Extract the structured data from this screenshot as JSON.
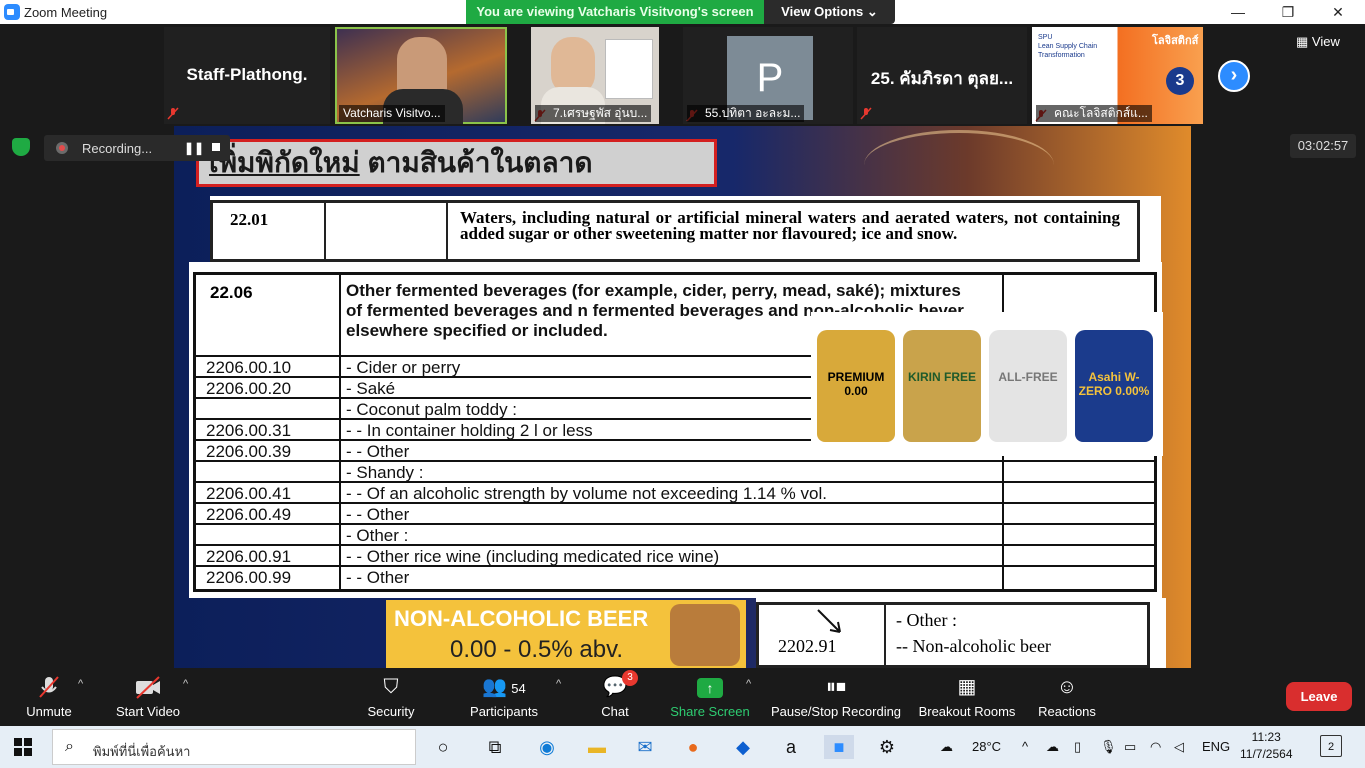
{
  "window": {
    "title": "Zoom Meeting",
    "viewing_banner": "You are viewing Vatcharis Visitvong's screen",
    "view_options": "View Options",
    "view_button": "View"
  },
  "gallery": {
    "tiles": [
      {
        "name": "Staff-Plathong."
      },
      {
        "label": "Vatcharis Visitvo..."
      },
      {
        "label": "7.เศรษฐพัส อุ่นบ..."
      },
      {
        "label": "55.ปทิตา อะละม...",
        "avatar_letter": "P"
      },
      {
        "name": "25. คัมภิรดา ตุลย..."
      },
      {
        "label": "คณะโลจิสติกส์แ..."
      }
    ]
  },
  "recording": {
    "label": "Recording..."
  },
  "timer": "03:02:57",
  "slide": {
    "title_underlined": "เพิ่มพิกัดใหม่",
    "title_rest": " ตามสินค้าในตลาด",
    "top_code": "22.01",
    "top_desc": "Waters, including natural or artificial mineral waters and aerated waters, not containing added sugar or other sweetening matter nor flavoured; ice and snow.",
    "header_code": "22.06",
    "header_desc": "Other fermented beverages (for example, cider, perry, mead, saké); mixtures of fermented beverages and n fermented beverages and non-alcoholic bever elsewhere specified or included.",
    "rows": [
      {
        "code": "2206.00.10",
        "desc": "- Cider or perry"
      },
      {
        "code": "2206.00.20",
        "desc": "- Saké"
      },
      {
        "code": "",
        "desc": "- Coconut palm toddy :"
      },
      {
        "code": "2206.00.31",
        "desc": "- - In container holding 2 l or less"
      },
      {
        "code": "2206.00.39",
        "desc": "- - Other"
      },
      {
        "code": "",
        "desc": "- Shandy :"
      },
      {
        "code": "2206.00.41",
        "desc": "- - Of an alcoholic strength by volume not exceeding 1.14 % vol."
      },
      {
        "code": "2206.00.49",
        "desc": "- - Other"
      },
      {
        "code": "",
        "desc": "- Other :"
      },
      {
        "code": "2206.00.91",
        "desc": "- - Other rice wine (including medicated rice wine)"
      },
      {
        "code": "2206.00.99",
        "desc": "- - Other"
      }
    ],
    "cans": [
      {
        "text": "PREMIUM 0.00",
        "color": "#d8a93a"
      },
      {
        "text": "KIRIN FREE",
        "color": "#c9a34b"
      },
      {
        "text": "ALL-FREE",
        "color": "#e4e4e4"
      },
      {
        "text": "Asahi W-ZERO 0.00%",
        "color": "#1b3b8c"
      }
    ],
    "beer_box_line1": "NON-ALCOHOLIC BEER",
    "beer_box_line2": "0.00 - 0.5% abv.",
    "bottom_code": "2202.91",
    "bottom_other": "- Other :",
    "bottom_nonalc": "--  Non-alcoholic beer"
  },
  "toolbar": {
    "unmute": "Unmute",
    "start_video": "Start Video",
    "security": "Security",
    "participants": "Participants",
    "participants_count": "54",
    "chat": "Chat",
    "chat_badge": "3",
    "share_screen": "Share Screen",
    "pause_stop": "Pause/Stop Recording",
    "breakout": "Breakout Rooms",
    "reactions": "Reactions",
    "leave": "Leave"
  },
  "taskbar": {
    "search_placeholder": "พิมพ์ที่นี่เพื่อค้นหา",
    "weather": "28°C",
    "lang": "ENG",
    "time": "11:23",
    "date": "11/7/2564",
    "notifications": "2"
  }
}
